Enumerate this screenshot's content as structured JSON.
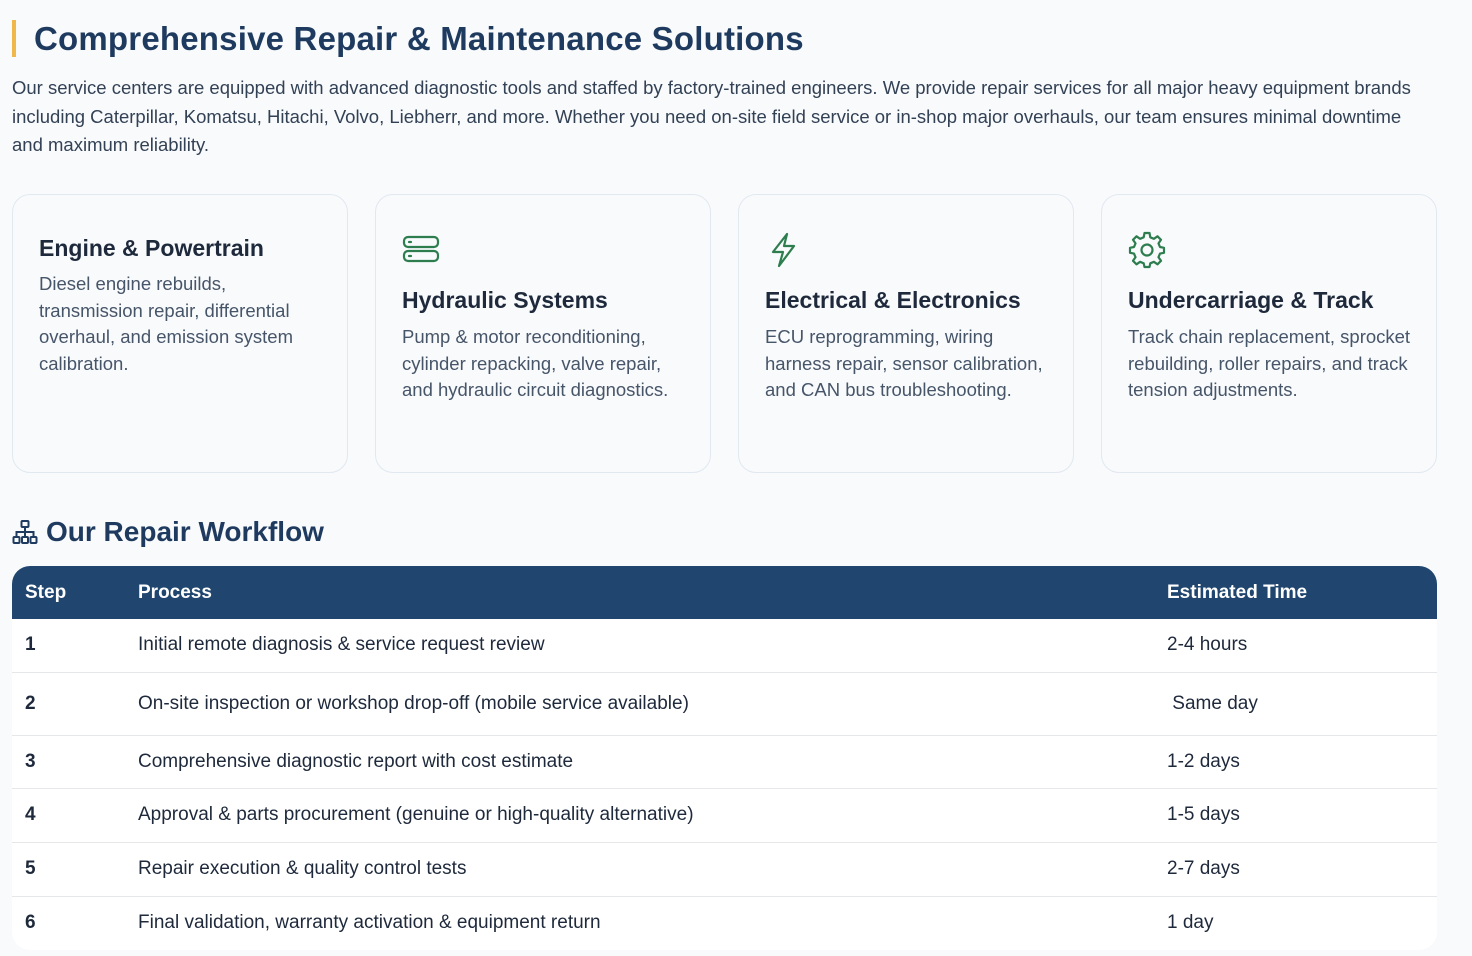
{
  "section": {
    "title": "Comprehensive Repair & Maintenance Solutions",
    "intro": "Our service centers are equipped with advanced diagnostic tools and staffed by factory-trained engineers. We provide repair services for all major heavy equipment brands including Caterpillar, Komatsu, Hitachi, Volvo, Liebherr, and more. Whether you need on-site field service or in-shop major overhauls, our team ensures minimal downtime and maximum reliability."
  },
  "cards": [
    {
      "title": "Engine & Powertrain",
      "text": "Diesel engine rebuilds, transmission repair, differential overhaul, and emission system calibration.",
      "icon": "none"
    },
    {
      "title": "Hydraulic Systems",
      "text": "Pump & motor reconditioning, cylinder repacking, valve repair, and hydraulic circuit diagnostics.",
      "icon": "server-icon"
    },
    {
      "title": "Electrical & Electronics",
      "text": "ECU reprogramming, wiring harness repair, sensor calibration, and CAN bus troubleshooting.",
      "icon": "lightning-icon"
    },
    {
      "title": "Undercarriage & Track",
      "text": "Track chain replacement, sprocket rebuilding, roller repairs, and track tension adjustments.",
      "icon": "gear-icon"
    }
  ],
  "workflow": {
    "title": "Our Repair Workflow",
    "icon": "sitemap-icon",
    "headers": {
      "step": "Step",
      "process": "Process",
      "time": "Estimated Time"
    },
    "rows": [
      {
        "step": "1",
        "process": "Initial remote diagnosis & service request review",
        "time": "2-4 hours"
      },
      {
        "step": "2",
        "process": "On-site inspection or workshop drop-off (mobile service available)",
        "time": " Same day"
      },
      {
        "step": "3",
        "process": "Comprehensive diagnostic report with cost estimate",
        "time": "1-2 days"
      },
      {
        "step": "4",
        "process": "Approval & parts procurement (genuine or high-quality alternative)",
        "time": "1-5 days"
      },
      {
        "step": "5",
        "process": "Repair execution & quality control tests",
        "time": "2-7 days"
      },
      {
        "step": "6",
        "process": "Final validation, warranty activation & equipment return",
        "time": "1 day"
      }
    ]
  },
  "colors": {
    "accent_bar": "#f0b84a",
    "heading": "#1f3a5f",
    "table_header": "#20466f",
    "icon_green": "#2e7d4f"
  }
}
